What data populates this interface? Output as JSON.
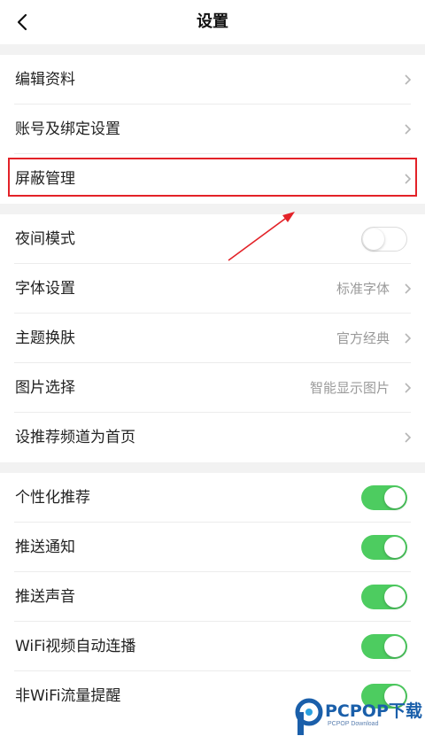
{
  "header": {
    "title": "设置",
    "back_icon": "chevron-left-icon"
  },
  "colors": {
    "toggle_on": "#4dcc60",
    "highlight": "#e32228",
    "arrow": "#e32228",
    "section_gap": "#f2f2f2"
  },
  "sections": [
    {
      "rows": [
        {
          "label": "编辑资料",
          "type": "link"
        },
        {
          "label": "账号及绑定设置",
          "type": "link"
        },
        {
          "label": "屏蔽管理",
          "type": "link",
          "highlighted": true
        }
      ]
    },
    {
      "rows": [
        {
          "label": "夜间模式",
          "type": "toggle",
          "on": false
        },
        {
          "label": "字体设置",
          "type": "link",
          "value": "标准字体"
        },
        {
          "label": "主题换肤",
          "type": "link",
          "value": "官方经典"
        },
        {
          "label": "图片选择",
          "type": "link",
          "value": "智能显示图片"
        },
        {
          "label": "设推荐频道为首页",
          "type": "link"
        }
      ]
    },
    {
      "rows": [
        {
          "label": "个性化推荐",
          "type": "toggle",
          "on": true
        },
        {
          "label": "推送通知",
          "type": "toggle",
          "on": true
        },
        {
          "label": "推送声音",
          "type": "toggle",
          "on": true
        },
        {
          "label": "WiFi视频自动连播",
          "type": "toggle",
          "on": true
        },
        {
          "label": "非WiFi流量提醒",
          "type": "toggle",
          "on": true
        }
      ]
    }
  ],
  "watermark": {
    "brand": "PCPOP下载",
    "sub": "PCPOP Download"
  }
}
